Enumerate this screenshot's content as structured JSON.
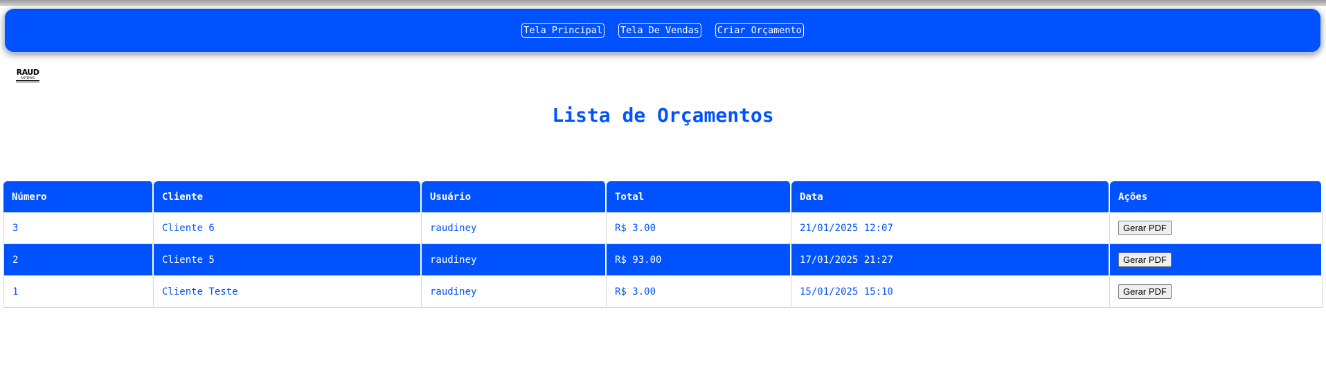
{
  "nav": {
    "buttons": [
      "Tela Principal",
      "Tela De Vendas",
      "Criar Orçamento"
    ]
  },
  "logo": {
    "line1": "RAUD",
    "line2": "SISTEMAS"
  },
  "page": {
    "title": "Lista de Orçamentos"
  },
  "table": {
    "headers": [
      "Número",
      "Cliente",
      "Usuário",
      "Total",
      "Data",
      "Ações"
    ],
    "rows": [
      {
        "numero": "3",
        "cliente": "Cliente 6",
        "usuario": "raudiney",
        "total": "R$ 3.00",
        "data": "21/01/2025 12:07",
        "acao": "Gerar PDF"
      },
      {
        "numero": "2",
        "cliente": "Cliente 5",
        "usuario": "raudiney",
        "total": "R$ 93.00",
        "data": "17/01/2025 21:27",
        "acao": "Gerar PDF"
      },
      {
        "numero": "1",
        "cliente": "Cliente Teste",
        "usuario": "raudiney",
        "total": "R$ 3.00",
        "data": "15/01/2025 15:10",
        "acao": "Gerar PDF"
      }
    ]
  },
  "colors": {
    "accent": "#0052ff",
    "background": "#ffffff"
  }
}
